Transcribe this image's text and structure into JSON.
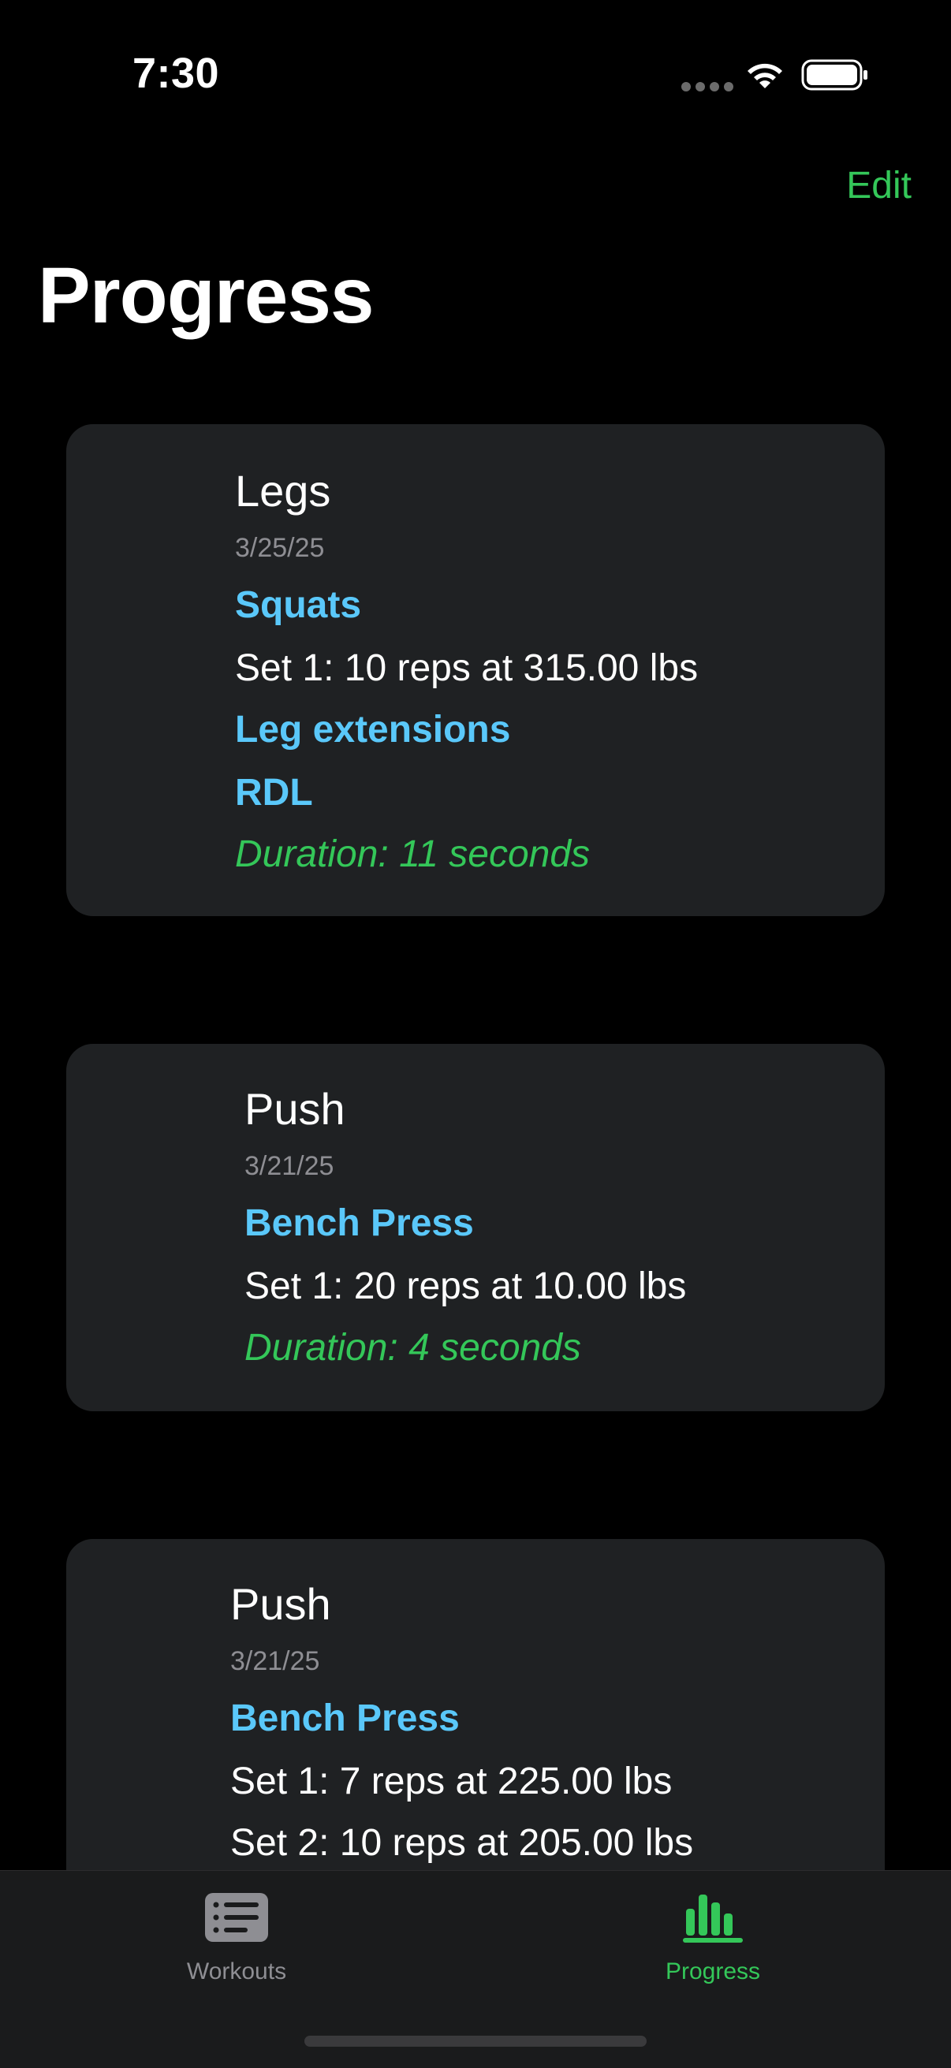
{
  "status_bar": {
    "time": "7:30",
    "icons": [
      "signal-icon",
      "wifi-icon",
      "battery-icon"
    ]
  },
  "nav": {
    "edit_label": "Edit",
    "title": "Progress"
  },
  "workouts": [
    {
      "name": "Legs",
      "date": "3/25/25",
      "exercises": [
        {
          "name": "Squats",
          "sets": [
            "Set 1: 10 reps at 315.00 lbs"
          ]
        },
        {
          "name": "Leg extensions",
          "sets": []
        },
        {
          "name": "RDL",
          "sets": []
        }
      ],
      "duration": "Duration: 11 seconds"
    },
    {
      "name": "Push",
      "date": "3/21/25",
      "exercises": [
        {
          "name": "Bench Press",
          "sets": [
            "Set 1: 20 reps at 10.00 lbs"
          ]
        }
      ],
      "duration": "Duration: 4 seconds"
    },
    {
      "name": "Push",
      "date": "3/21/25",
      "exercises": [
        {
          "name": "Bench Press",
          "sets": [
            "Set 1: 7 reps at 225.00 lbs",
            "Set 2: 10 reps at 205.00 lbs"
          ]
        }
      ],
      "duration": ""
    }
  ],
  "tab_bar": {
    "tabs": [
      {
        "label": "Workouts",
        "icon": "list-icon",
        "selected": false
      },
      {
        "label": "Progress",
        "icon": "chart-bar-icon",
        "selected": true
      }
    ]
  },
  "colors": {
    "accent": "#34c759",
    "exercise": "#5ac8fa",
    "card_bg": "#1f2123",
    "secondary_text": "#8e8e93"
  }
}
